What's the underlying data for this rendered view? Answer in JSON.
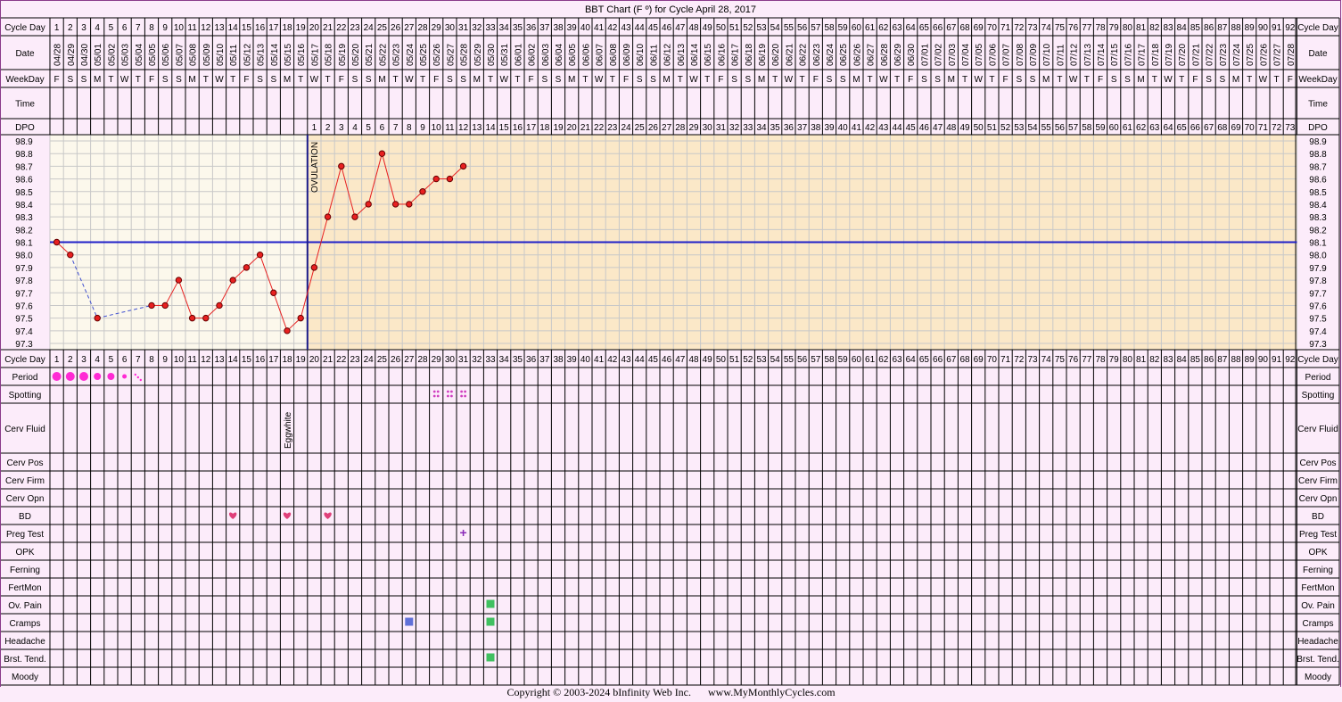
{
  "title": "BBT Chart (F º) for Cycle April 28, 2017",
  "row_labels": {
    "cycle_day": "Cycle Day",
    "date": "Date",
    "weekday": "WeekDay",
    "time": "Time",
    "dpo": "DPO",
    "period": "Period",
    "spotting": "Spotting",
    "cerv_fluid": "Cerv Fluid",
    "cerv_pos": "Cerv Pos",
    "cerv_firm": "Cerv Firm",
    "cerv_opn": "Cerv Opn",
    "bd": "BD",
    "preg_test": "Preg Test",
    "opk": "OPK",
    "ferning": "Ferning",
    "fertmon": "FertMon",
    "ov_pain": "Ov. Pain",
    "cramps": "Cramps",
    "headache": "Headache",
    "brst_tend": "Brst. Tend.",
    "moody": "Moody"
  },
  "dates": [
    "04/28",
    "04/29",
    "04/30",
    "05/01",
    "05/02",
    "05/03",
    "05/04",
    "05/05",
    "05/06",
    "05/07",
    "05/08",
    "05/09",
    "05/10",
    "05/11",
    "05/12",
    "05/13",
    "05/14",
    "05/15",
    "05/16",
    "05/17",
    "05/18",
    "05/19",
    "05/20",
    "05/21",
    "05/22",
    "05/23",
    "05/24",
    "05/25",
    "05/26",
    "05/27",
    "05/28",
    "05/29",
    "05/30",
    "05/31",
    "06/01",
    "06/02",
    "06/03",
    "06/04",
    "06/05",
    "06/06",
    "06/07",
    "06/08",
    "06/09",
    "06/10",
    "06/11",
    "06/12",
    "06/13",
    "06/14",
    "06/15",
    "06/16",
    "06/17",
    "06/18",
    "06/19",
    "06/20",
    "06/21",
    "06/22",
    "06/23",
    "06/24",
    "06/25",
    "06/26",
    "06/27",
    "06/28",
    "06/29",
    "06/30",
    "07/01",
    "07/02",
    "07/03",
    "07/04",
    "07/05",
    "07/06",
    "07/07",
    "07/08",
    "07/09",
    "07/10",
    "07/11",
    "07/12",
    "07/13",
    "07/14",
    "07/15",
    "07/16",
    "07/17",
    "07/18",
    "07/19",
    "07/20",
    "07/21",
    "07/22",
    "07/23",
    "07/24",
    "07/25",
    "07/26",
    "07/27",
    "07/28"
  ],
  "weekdays": [
    "F",
    "S",
    "S",
    "M",
    "T",
    "W",
    "T",
    "F",
    "S",
    "S",
    "M",
    "T",
    "W",
    "T",
    "F",
    "S",
    "S",
    "M",
    "T",
    "W",
    "T",
    "F",
    "S",
    "S",
    "M",
    "T",
    "W",
    "T",
    "F",
    "S",
    "S",
    "M",
    "T",
    "W",
    "T",
    "F",
    "S",
    "S",
    "M",
    "T",
    "W",
    "T",
    "F",
    "S",
    "S",
    "M",
    "T",
    "W",
    "T",
    "F",
    "S",
    "S",
    "M",
    "T",
    "W",
    "T",
    "F",
    "S",
    "S",
    "M",
    "T",
    "W",
    "T",
    "F",
    "S",
    "S",
    "M",
    "T",
    "W",
    "T",
    "F",
    "S",
    "S",
    "M",
    "T",
    "W",
    "T",
    "F",
    "S",
    "S",
    "M",
    "T",
    "W",
    "T",
    "F",
    "S",
    "S",
    "M",
    "T",
    "W",
    "T",
    "F"
  ],
  "dpo_start_day": 20,
  "dpo_count": 73,
  "temp_ticks": [
    "98.9",
    "98.8",
    "98.7",
    "98.6",
    "98.5",
    "98.4",
    "98.3",
    "98.2",
    "98.1",
    "98.0",
    "97.9",
    "97.8",
    "97.7",
    "97.6",
    "97.5",
    "97.4",
    "97.3"
  ],
  "ovulation_label": "OVULATION",
  "cerv_fluid_note": "Eggwhite",
  "cerv_fluid_day": 18,
  "copyright": "Copyright © 2003-2024 bInfinity Web Inc.",
  "site": "www.MyMonthlyCycles.com",
  "colors": {
    "background": "#fcecfa",
    "border": "#8a3a8a",
    "pre_ovulation_fill": "#fcf8ec",
    "post_ovulation_fill": "#fbe8c8",
    "grid": "#c8c8c8",
    "temp_line": "#e82020",
    "point_fill": "#e82020",
    "coverline": "#2020c8",
    "ovulation_line": "#1a1a8a",
    "period": "#ff2ad4",
    "spotting": "#d040c0",
    "bd_heart": "#e0407a",
    "preg_test": "#8a2ab8",
    "ov_pain": "#40c060",
    "cramps_blue": "#6070d8",
    "cramps_green": "#40c060",
    "brst_tend": "#40c060"
  },
  "chart_data": {
    "type": "line",
    "title": "BBT Chart (F º) for Cycle April 28, 2017",
    "xlabel": "Cycle Day",
    "ylabel": "",
    "x_range": [
      1,
      92
    ],
    "ylim": [
      97.3,
      98.9
    ],
    "coverline": 98.1,
    "ovulation_day": 19,
    "grid": true,
    "series": [
      {
        "x": [
          1,
          2,
          4,
          8,
          9,
          10,
          11,
          12,
          13,
          14,
          15,
          16,
          17,
          18,
          19,
          20,
          21,
          22,
          23,
          24,
          25,
          26,
          27,
          28,
          29,
          30,
          31
        ],
        "y": [
          98.1,
          98.0,
          97.5,
          97.6,
          97.6,
          97.8,
          97.5,
          97.5,
          97.6,
          97.8,
          97.9,
          98.0,
          97.7,
          97.4,
          97.5,
          97.9,
          98.3,
          98.7,
          98.3,
          98.4,
          98.8,
          98.4,
          98.4,
          98.5,
          98.6,
          98.6,
          98.7
        ],
        "dashed_segments": [
          [
            2,
            4
          ],
          [
            4,
            8
          ]
        ]
      }
    ],
    "period": [
      {
        "day": 1,
        "level": "heavy"
      },
      {
        "day": 2,
        "level": "heavy"
      },
      {
        "day": 3,
        "level": "heavy"
      },
      {
        "day": 4,
        "level": "medium"
      },
      {
        "day": 5,
        "level": "medium"
      },
      {
        "day": 6,
        "level": "light"
      },
      {
        "day": 7,
        "level": "spotting"
      }
    ],
    "spotting_days": [
      29,
      30,
      31
    ],
    "bd_days": [
      14,
      18,
      21
    ],
    "preg_test": [
      {
        "day": 31,
        "result": "+"
      }
    ],
    "ov_pain_days": [
      33
    ],
    "cramps": [
      {
        "day": 27,
        "color": "blue"
      },
      {
        "day": 33,
        "color": "green"
      }
    ],
    "brst_tend_days": [
      33
    ]
  }
}
